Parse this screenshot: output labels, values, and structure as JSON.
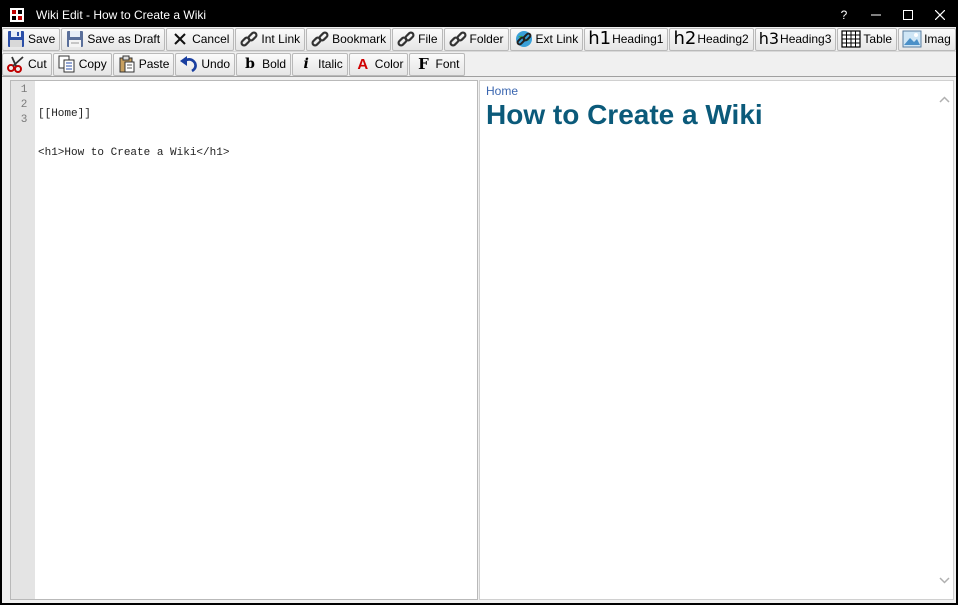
{
  "window": {
    "title": "Wiki Edit - How to Create a Wiki",
    "help_label": "?"
  },
  "toolbar_primary": [
    {
      "id": "save",
      "label": "Save",
      "icon": "floppy-disk-icon"
    },
    {
      "id": "save-draft",
      "label": "Save as Draft",
      "icon": "floppy-disk-draft-icon"
    },
    {
      "id": "cancel",
      "label": "Cancel",
      "icon": "x-icon"
    },
    {
      "id": "int-link",
      "label": "Int Link",
      "icon": "chain-link-icon"
    },
    {
      "id": "bookmark",
      "label": "Bookmark",
      "icon": "chain-link-icon"
    },
    {
      "id": "file",
      "label": "File",
      "icon": "chain-link-icon"
    },
    {
      "id": "folder",
      "label": "Folder",
      "icon": "chain-link-icon"
    },
    {
      "id": "ext-link",
      "label": "Ext Link",
      "icon": "globe-link-icon"
    },
    {
      "id": "heading1",
      "label": "Heading1",
      "icon_text": "h1"
    },
    {
      "id": "heading2",
      "label": "Heading2",
      "icon_text": "h2"
    },
    {
      "id": "heading3",
      "label": "Heading3",
      "icon_text": "h3"
    },
    {
      "id": "table",
      "label": "Table",
      "icon": "table-grid-icon"
    },
    {
      "id": "image",
      "label": "Imag",
      "icon": "picture-icon"
    }
  ],
  "toolbar_secondary": [
    {
      "id": "cut",
      "label": "Cut",
      "icon": "scissors-icon"
    },
    {
      "id": "copy",
      "label": "Copy",
      "icon": "copy-pages-icon"
    },
    {
      "id": "paste",
      "label": "Paste",
      "icon": "clipboard-icon"
    },
    {
      "id": "undo",
      "label": "Undo",
      "icon": "undo-arrow-icon"
    },
    {
      "id": "bold",
      "label": "Bold",
      "icon_text": "b"
    },
    {
      "id": "italic",
      "label": "Italic",
      "icon_text": "i"
    },
    {
      "id": "color",
      "label": "Color",
      "icon_text": "A"
    },
    {
      "id": "font",
      "label": "Font",
      "icon_text": "F"
    }
  ],
  "editor": {
    "line_numbers": [
      "1",
      "2",
      "3"
    ],
    "lines": [
      "[[Home]]",
      "<h1>How to Create a Wiki</h1>",
      ""
    ]
  },
  "preview": {
    "breadcrumb": "Home",
    "heading": "How to Create a Wiki"
  },
  "colors": {
    "title_bar": "#000000",
    "heading": "#0b5a7a",
    "link": "#3a66b0",
    "gutter": "#e4e4e4"
  }
}
